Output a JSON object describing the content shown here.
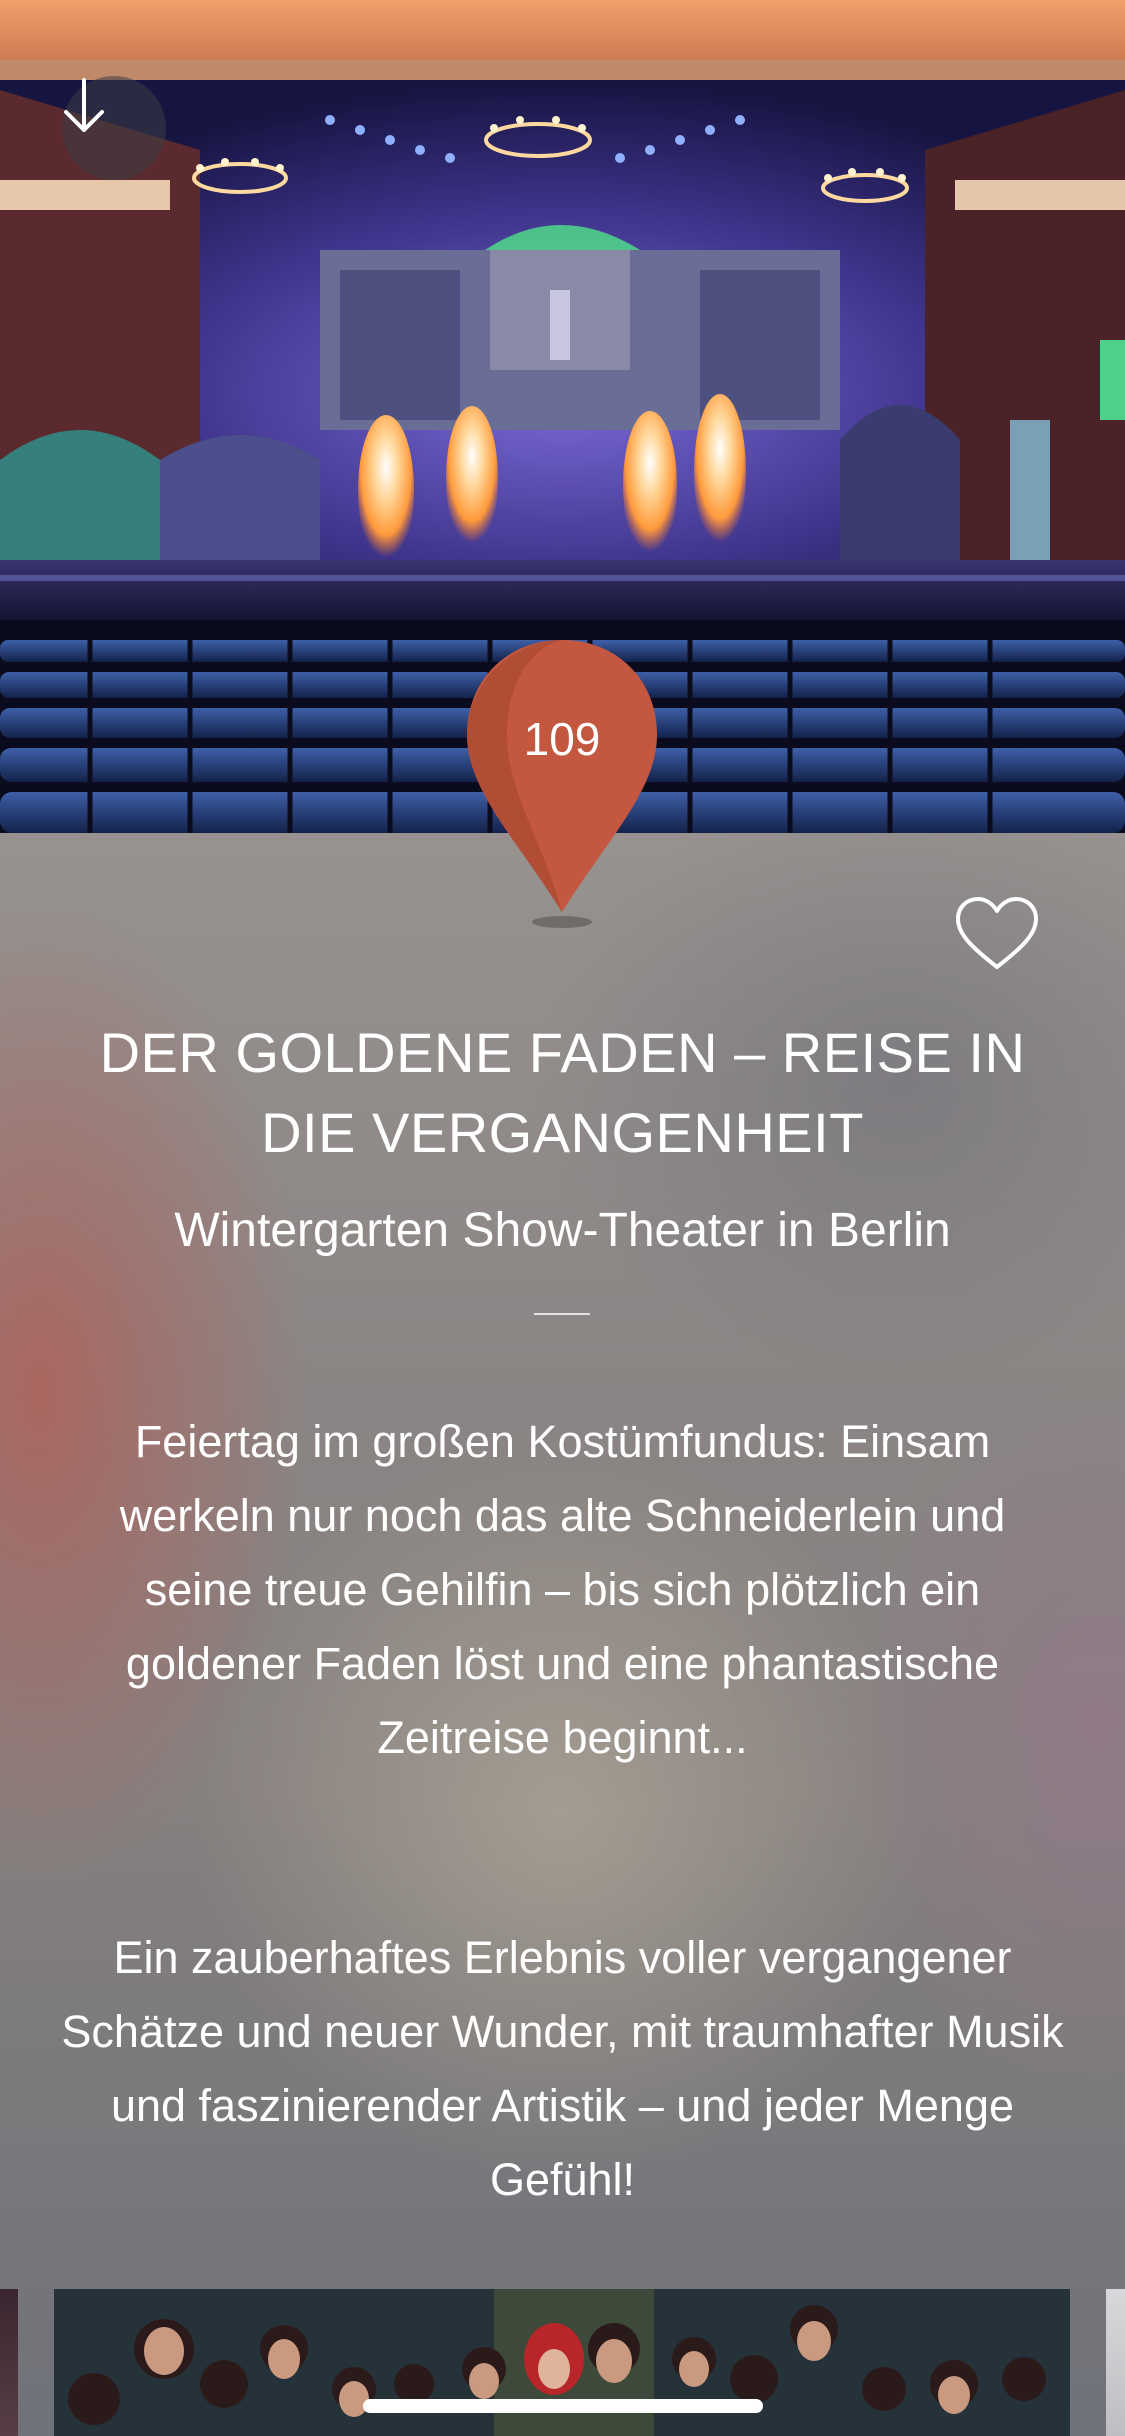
{
  "event": {
    "pin_number": "109",
    "title": "DER GOLDENE FADEN – REISE IN DIE VERGANGENHEIT",
    "venue": "Wintergarten Show-Theater in Berlin",
    "description_paragraph_1": "Feiertag im großen Kostümfundus: Einsam werkeln nur noch das alte Schneiderlein und seine treue Gehilfin – bis sich plötzlich ein goldener Faden löst und eine phantastische Zeitreise beginnt...",
    "description_paragraph_2": "Ein zauberhaftes Erlebnis voller vergangener Schätze und neuer Wunder, mit traumhafter Musik und faszinierender Artistik – und jeder Menge Gefühl!"
  },
  "icons": {
    "back": "arrow-down-icon",
    "favorite": "heart-outline-icon",
    "pin": "map-pin-icon"
  },
  "colors": {
    "pin": "#c4573f",
    "pin_shade": "#a94832",
    "text": "#ffffff"
  }
}
